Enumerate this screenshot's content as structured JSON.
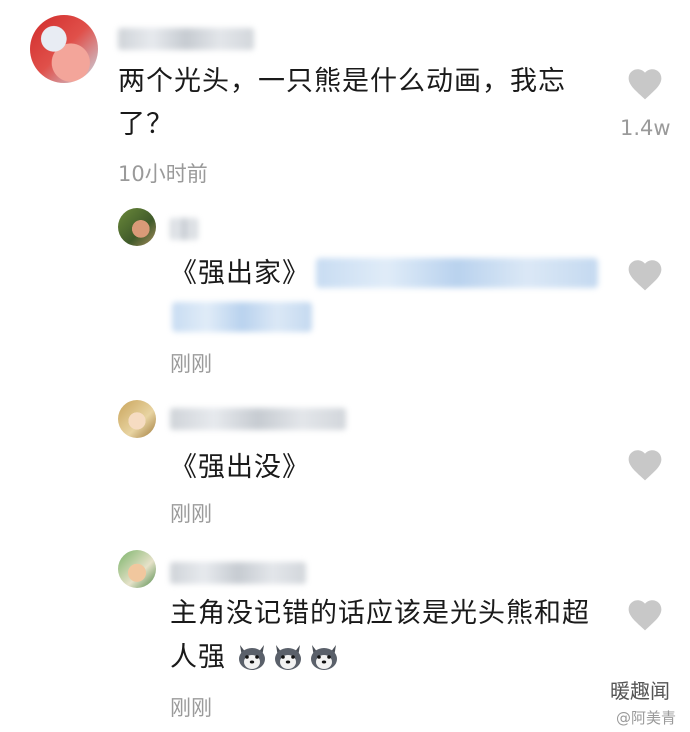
{
  "comments": [
    {
      "text_line1": "两个光头，一只熊是什么动画，我忘",
      "text_line2": "了？",
      "time": "10小时前",
      "likes": "1.4w"
    }
  ],
  "replies": [
    {
      "text_prefix": "《强出家》",
      "time": "刚刚"
    },
    {
      "text": "《强出没》",
      "time": "刚刚"
    },
    {
      "text_line1": "主角没记错的话应该是光头熊和超",
      "text_line2": "人强",
      "time": "刚刚"
    }
  ],
  "watermark": {
    "title": "暖趣闻",
    "sub": "@阿美青"
  },
  "colors": {
    "heart": "#c8c8c8",
    "meta": "#9a9a9a",
    "text": "#1a1a1a"
  }
}
